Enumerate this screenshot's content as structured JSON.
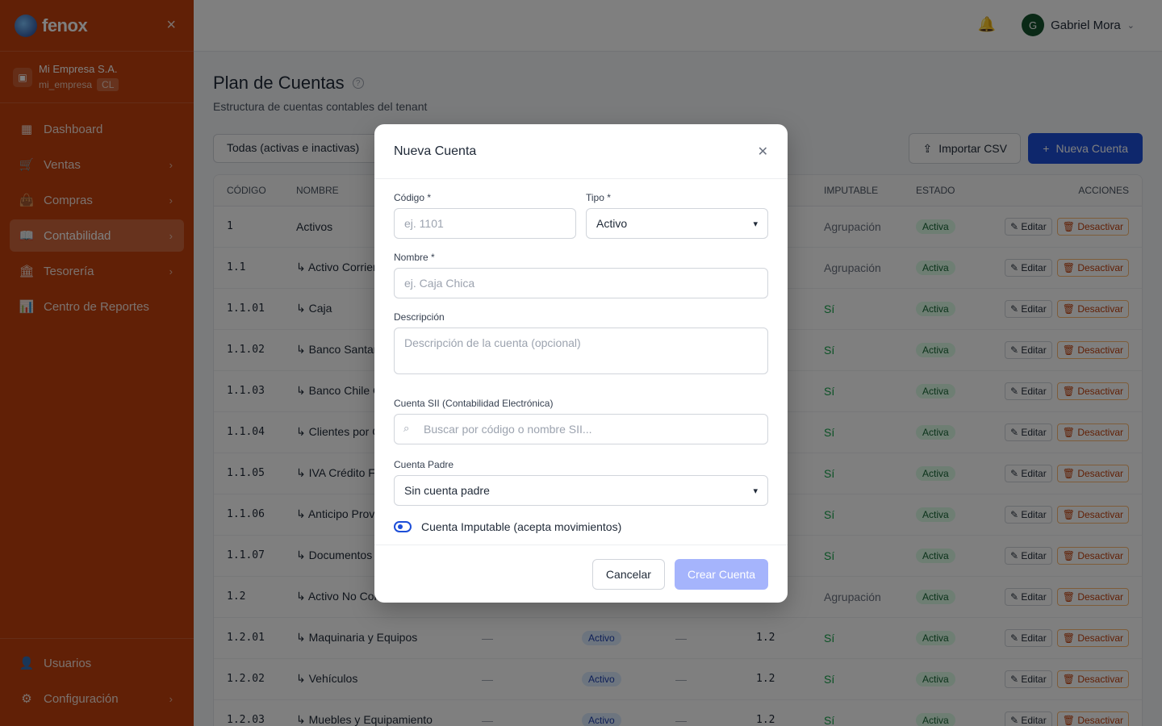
{
  "brand": {
    "name": "fenox"
  },
  "company": {
    "name": "Mi Empresa S.A.",
    "slug": "mi_empresa",
    "country": "CL"
  },
  "sidebar": {
    "items": [
      {
        "label": "Dashboard",
        "icon": "grid-icon",
        "chevron": false
      },
      {
        "label": "Ventas",
        "icon": "cart-icon",
        "chevron": true
      },
      {
        "label": "Compras",
        "icon": "bag-icon",
        "chevron": true
      },
      {
        "label": "Contabilidad",
        "icon": "book-icon",
        "chevron": true,
        "active": true
      },
      {
        "label": "Tesorería",
        "icon": "bank-icon",
        "chevron": true
      },
      {
        "label": "Centro de Reportes",
        "icon": "chart-icon",
        "chevron": false
      }
    ],
    "bottom": [
      {
        "label": "Usuarios",
        "icon": "user-icon"
      },
      {
        "label": "Configuración",
        "icon": "gear-icon"
      }
    ]
  },
  "header": {
    "user_initial": "G",
    "user_name": "Gabriel Mora"
  },
  "page": {
    "title": "Plan de Cuentas",
    "subtitle": "Estructura de cuentas contables del tenant",
    "filter": "Todas (activas e inactivas)",
    "import_label": "Importar CSV",
    "new_label": "Nueva Cuenta"
  },
  "table": {
    "headers": {
      "codigo": "CÓDIGO",
      "nombre": "NOMBRE",
      "imputable": "IMPUTABLE",
      "estado": "ESTADO",
      "acciones": "ACCIONES"
    },
    "rows": [
      {
        "code": "1",
        "name": "Activos",
        "type": "",
        "parent": "",
        "imputable": "Agrupación",
        "estado": "Activa"
      },
      {
        "code": "1.1",
        "name": "↳ Activo Corrien",
        "type": "",
        "parent": "",
        "imputable": "Agrupación",
        "estado": "Activa"
      },
      {
        "code": "1.1.01",
        "name": "↳ Caja",
        "type": "",
        "parent": "",
        "imputable": "Sí",
        "estado": "Activa"
      },
      {
        "code": "1.1.02",
        "name": "↳ Banco Santan",
        "type": "",
        "parent": "",
        "imputable": "Sí",
        "estado": "Activa"
      },
      {
        "code": "1.1.03",
        "name": "↳ Banco Chile C",
        "type": "",
        "parent": "",
        "imputable": "Sí",
        "estado": "Activa"
      },
      {
        "code": "1.1.04",
        "name": "↳ Clientes por C",
        "type": "",
        "parent": "",
        "imputable": "Sí",
        "estado": "Activa"
      },
      {
        "code": "1.1.05",
        "name": "↳ IVA Crédito Fi",
        "type": "",
        "parent": "",
        "imputable": "Sí",
        "estado": "Activa"
      },
      {
        "code": "1.1.06",
        "name": "↳ Anticipo Prov",
        "type": "",
        "parent": "",
        "imputable": "Sí",
        "estado": "Activa"
      },
      {
        "code": "1.1.07",
        "name": "↳ Documentos p",
        "type": "",
        "parent": "",
        "imputable": "Sí",
        "estado": "Activa"
      },
      {
        "code": "1.2",
        "name": "↳ Activo No Cor",
        "type": "",
        "parent": "",
        "imputable": "Agrupación",
        "estado": "Activa"
      },
      {
        "code": "1.2.01",
        "name": "↳ Maquinaria y Equipos",
        "type": "Activo",
        "parent": "1.2",
        "imputable": "Sí",
        "estado": "Activa"
      },
      {
        "code": "1.2.02",
        "name": "↳ Vehículos",
        "type": "Activo",
        "parent": "1.2",
        "imputable": "Sí",
        "estado": "Activa"
      },
      {
        "code": "1.2.03",
        "name": "↳ Muebles y Equipamiento",
        "type": "Activo",
        "parent": "1.2",
        "imputable": "Sí",
        "estado": "Activa"
      }
    ],
    "edit_label": "Editar",
    "deactivate_label": "Desactivar",
    "dash": "—"
  },
  "modal": {
    "title": "Nueva Cuenta",
    "codigo_label": "Código *",
    "codigo_placeholder": "ej. 1101",
    "tipo_label": "Tipo *",
    "tipo_value": "Activo",
    "nombre_label": "Nombre *",
    "nombre_placeholder": "ej. Caja Chica",
    "descripcion_label": "Descripción",
    "descripcion_placeholder": "Descripción de la cuenta (opcional)",
    "sii_label": "Cuenta SII (Contabilidad Electrónica)",
    "sii_placeholder": "Buscar por código o nombre SII...",
    "padre_label": "Cuenta Padre",
    "padre_value": "Sin cuenta padre",
    "imputable_label": "Cuenta Imputable (acepta movimientos)",
    "cancel_label": "Cancelar",
    "create_label": "Crear Cuenta"
  }
}
